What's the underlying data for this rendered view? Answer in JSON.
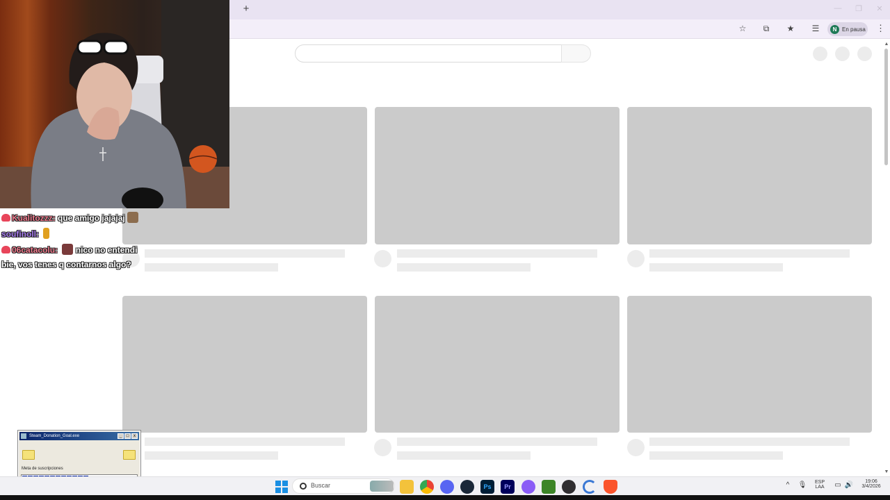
{
  "browser": {
    "new_tab_label": "+",
    "toolbar_icons": [
      "star-icon",
      "extensions-icon",
      "bookmarks-icon",
      "reading-list-icon"
    ],
    "profile": {
      "initial": "N",
      "status": "En pausa"
    },
    "menu_label": "⋮"
  },
  "chat": {
    "messages": [
      {
        "user": "Kualitozzz:",
        "text": "que amigo jajajaj"
      },
      {
        "user": "soufinoll:",
        "text": ""
      },
      {
        "badge": "06",
        "user": "catacolu:",
        "text": "nico no entendi"
      },
      {
        "text": "bie, vos tenes q contarnos algo?"
      }
    ]
  },
  "donation_widget": {
    "title": "Steam_Donation_Goal.exe",
    "label": "Meta de suscripciones",
    "progress_fraction": 0.58
  },
  "taskbar": {
    "search_placeholder": "Buscar",
    "apps": [
      "start-icon",
      "weather-widget-icon",
      "file-explorer-icon",
      "chrome-icon",
      "discord-icon",
      "steam-icon",
      "photoshop-icon",
      "premiere-icon",
      "app-purple-icon",
      "minecraft-icon",
      "obs-icon",
      "app-loading-icon",
      "brave-icon"
    ],
    "photoshop_label": "Ps",
    "premiere_label": "Pr",
    "lang": "ESP",
    "lang_sub": "LAA",
    "time": "19:06",
    "date": "3/4/2026"
  },
  "colors": {
    "tabstrip": "#e9e3f2",
    "toolbar": "#f3eef9",
    "skeleton": "#cbcbcb",
    "skeleton_light": "#ececec"
  }
}
